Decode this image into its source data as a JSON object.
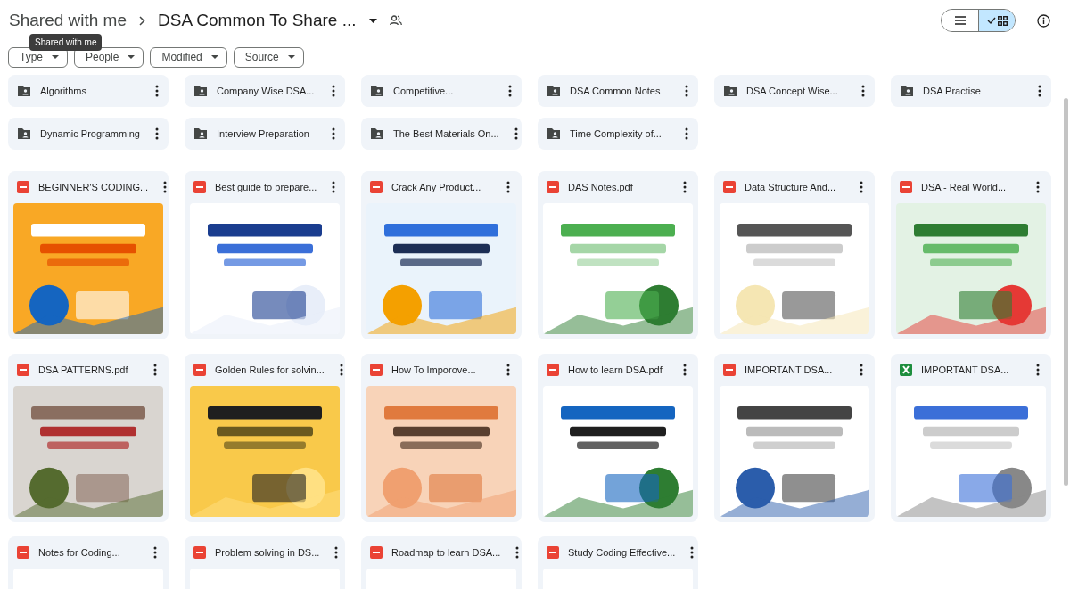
{
  "breadcrumb": {
    "parent": "Shared with me",
    "current": "DSA Common To Share ..."
  },
  "tooltip": "Shared with me",
  "view_toggle": [
    {
      "kind": "list",
      "selected": false
    },
    {
      "kind": "grid",
      "selected": true
    }
  ],
  "filters": [
    "Type",
    "People",
    "Modified",
    "Source"
  ],
  "folders": [
    {
      "name": "Algorithms"
    },
    {
      "name": "Company Wise DSA..."
    },
    {
      "name": "Competitive..."
    },
    {
      "name": "DSA Common Notes"
    },
    {
      "name": "DSA Concept Wise..."
    },
    {
      "name": "DSA Practise"
    },
    {
      "name": "Dynamic Programming"
    },
    {
      "name": "Interview Preparation"
    },
    {
      "name": "The Best Materials On..."
    },
    {
      "name": "Time Complexity of..."
    }
  ],
  "files": [
    {
      "name": "BEGINNER'S CODING...",
      "kind": "pdf"
    },
    {
      "name": "Best guide to prepare...",
      "kind": "pdf"
    },
    {
      "name": "Crack Any Product...",
      "kind": "pdf"
    },
    {
      "name": "DAS Notes.pdf",
      "kind": "pdf"
    },
    {
      "name": "Data Structure And...",
      "kind": "pdf"
    },
    {
      "name": "DSA - Real World...",
      "kind": "pdf"
    },
    {
      "name": "DSA PATTERNS.pdf",
      "kind": "pdf"
    },
    {
      "name": "Golden Rules for solvin...",
      "kind": "pdf"
    },
    {
      "name": "How To Imporove...",
      "kind": "pdf"
    },
    {
      "name": "How to learn DSA.pdf",
      "kind": "pdf"
    },
    {
      "name": "IMPORTANT DSA...",
      "kind": "pdf"
    },
    {
      "name": "IMPORTANT DSA...",
      "kind": "sheet"
    },
    {
      "name": "Notes for Coding...",
      "kind": "pdf"
    },
    {
      "name": "Problem solving in DS...",
      "kind": "pdf"
    },
    {
      "name": "Roadmap to learn DSA...",
      "kind": "pdf"
    },
    {
      "name": "Study Coding Effective...",
      "kind": "pdf"
    }
  ]
}
